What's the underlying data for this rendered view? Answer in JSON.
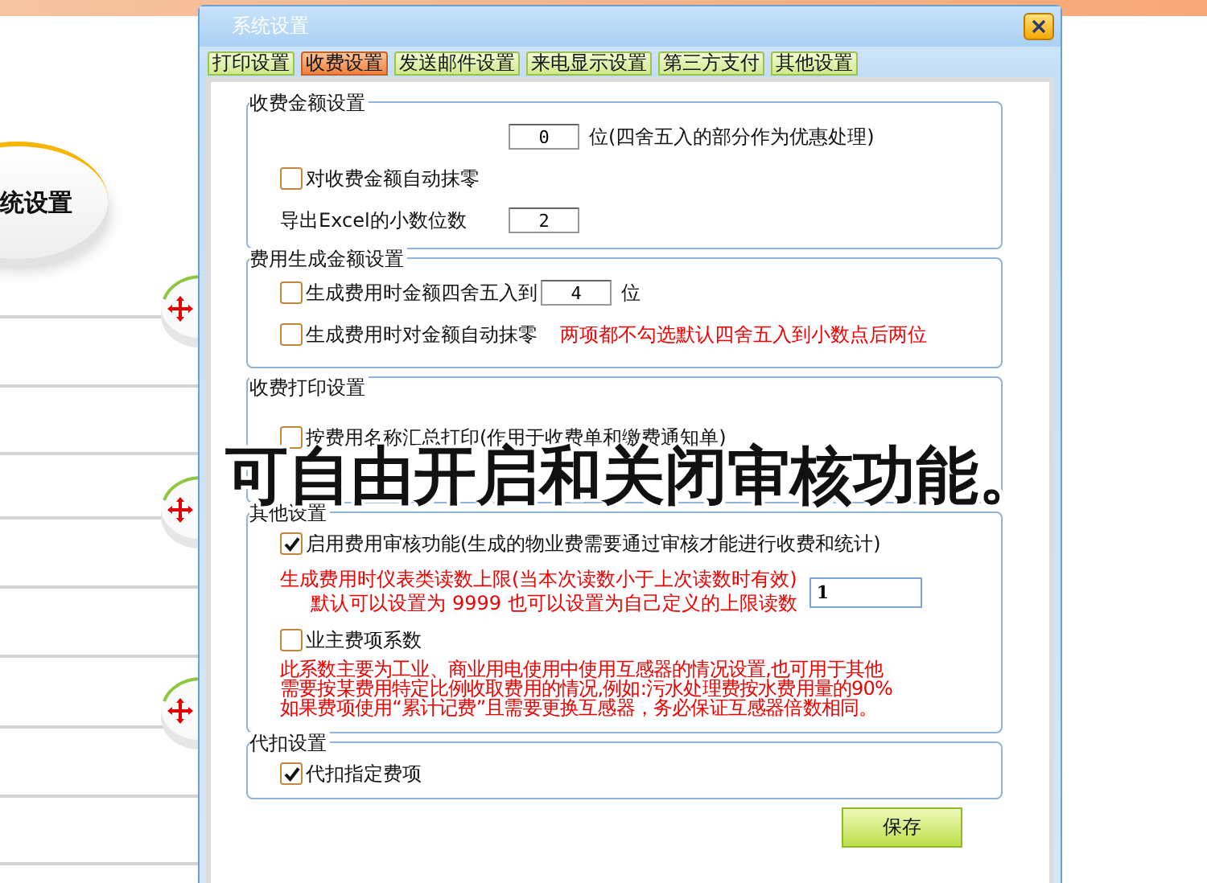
{
  "window": {
    "title": "系统设置"
  },
  "background": {
    "heading": "统设置"
  },
  "tabs": [
    {
      "label": "打印设置",
      "selected": false
    },
    {
      "label": "收费设置",
      "selected": true
    },
    {
      "label": "发送邮件设置",
      "selected": false
    },
    {
      "label": "来电显示设置",
      "selected": false
    },
    {
      "label": "第三方支付",
      "selected": false
    },
    {
      "label": "其他设置",
      "selected": false
    }
  ],
  "groups": [
    {
      "title": "收费金额设置",
      "rows": [
        {
          "kind": "field",
          "value": "0",
          "suffix": "位(四舍五入的部分作为优惠处理)"
        },
        {
          "kind": "checkbox",
          "label": "对收费金额自动抹零",
          "checked": false
        },
        {
          "kind": "field",
          "label": "导出Excel的小数位数",
          "value": "2"
        }
      ]
    },
    {
      "title": "费用生成金额设置",
      "rows": [
        {
          "kind": "checkbox",
          "label": "生成费用时金额四舍五入到",
          "checked": false,
          "value": "4",
          "suffix": "位"
        },
        {
          "kind": "checkbox",
          "label": "生成费用时对金额自动抹零",
          "checked": false,
          "note": "两项都不勾选默认四舍五入到小数点后两位"
        }
      ]
    },
    {
      "title": "收费打印设置",
      "rows": [
        {
          "kind": "checkbox",
          "label": "按费用名称汇总打印(作用于收费单和缴费通知单)",
          "checked": false
        }
      ]
    },
    {
      "title": "其他设置",
      "rows": [
        {
          "kind": "checkbox",
          "label": "启用费用审核功能(生成的物业费需要通过审核才能进行收费和统计)",
          "checked": true
        },
        {
          "kind": "note",
          "lines": [
            "生成费用时仪表类读数上限(当本次读数小于上次读数时有效)",
            "默认可以设置为 9999 也可以设置为自己定义的上限读数"
          ],
          "value": "1"
        },
        {
          "kind": "checkbox",
          "label": "业主费项系数",
          "checked": false
        },
        {
          "kind": "note",
          "lines": [
            "此系数主要为工业、商业用电使用中使用互感器的情况设置,也可用于其他",
            "需要按某费用特定比例收取费用的情况,例如:污水处理费按水费用量的90%",
            "如果费项使用“累计记费”且需要更换互感器，务必保证互感器倍数相同。"
          ]
        }
      ]
    },
    {
      "title": "代扣设置",
      "rows": [
        {
          "kind": "checkbox",
          "label": "代扣指定费项",
          "checked": true
        }
      ]
    }
  ],
  "save_button": "保存",
  "caption": "可自由开启和关闭审核功能。"
}
